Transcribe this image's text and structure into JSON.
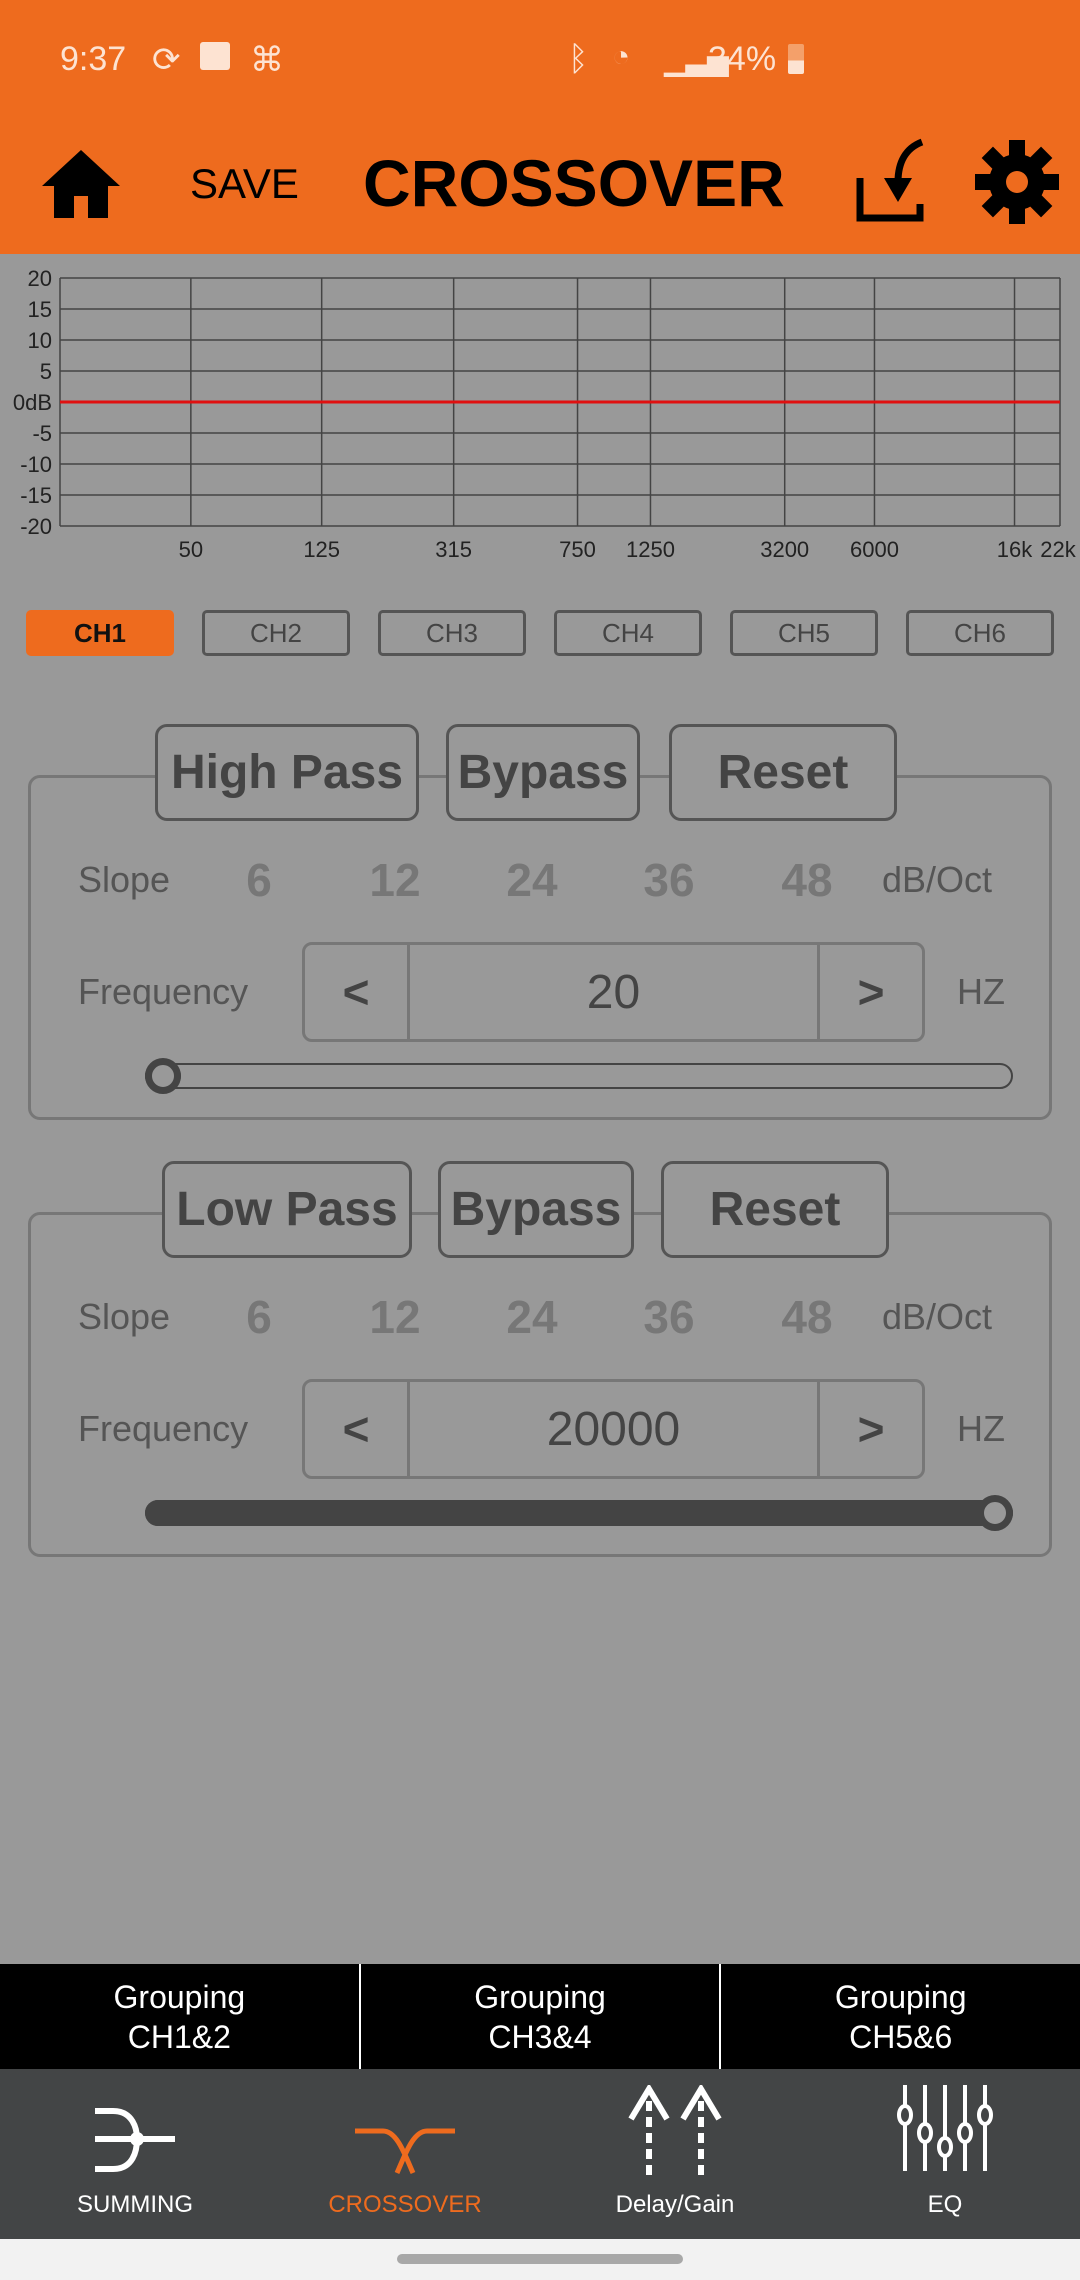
{
  "status_bar": {
    "time": "9:37",
    "battery": "34%",
    "icons": [
      "sync-icon",
      "gallery-icon",
      "app-icon",
      "bluetooth-icon",
      "wifi-icon",
      "signal-icon",
      "battery-icon"
    ]
  },
  "header": {
    "title": "CROSSOVER",
    "save_label": "SAVE",
    "icons": [
      "home-icon",
      "export-icon",
      "gear-icon"
    ],
    "bg_color": "#EE6B1E"
  },
  "chart_data": {
    "type": "line",
    "x_scale": "log",
    "xlim": [
      20,
      22000
    ],
    "ylim": [
      -20,
      20
    ],
    "y_ticks": [
      "20",
      "15",
      "10",
      "5",
      "0dB",
      "-5",
      "-10",
      "-15",
      "-20"
    ],
    "y_tick_values": [
      20,
      15,
      10,
      5,
      0,
      -5,
      -10,
      -15,
      -20
    ],
    "x_ticks": [
      "50",
      "125",
      "315",
      "750",
      "1250",
      "3200",
      "6000",
      "16k",
      "22k"
    ],
    "x_tick_values": [
      50,
      125,
      315,
      750,
      1250,
      3200,
      6000,
      16000,
      22000
    ],
    "grid": true,
    "series": [
      {
        "x": [
          20,
          22000
        ],
        "y": [
          0,
          0
        ],
        "color": "#E01010"
      }
    ]
  },
  "channels": {
    "items": [
      "CH1",
      "CH2",
      "CH3",
      "CH4",
      "CH5",
      "CH6"
    ],
    "selected": "CH1"
  },
  "high_pass": {
    "title": "High Pass",
    "bypass": "Bypass",
    "reset": "Reset",
    "slope_label": "Slope",
    "slopes": [
      "6",
      "12",
      "24",
      "36",
      "48"
    ],
    "slope_unit": "dB/Oct",
    "freq_label": "Frequency",
    "prev": "<",
    "next": ">",
    "value": "20",
    "unit": "HZ",
    "slider_fraction": 0
  },
  "low_pass": {
    "title": "Low Pass",
    "bypass": "Bypass",
    "reset": "Reset",
    "slope_label": "Slope",
    "slopes": [
      "6",
      "12",
      "24",
      "36",
      "48"
    ],
    "slope_unit": "dB/Oct",
    "freq_label": "Frequency",
    "prev": "<",
    "next": ">",
    "value": "20000",
    "unit": "HZ",
    "slider_fraction": 1
  },
  "grouping": [
    {
      "line1": "Grouping",
      "line2": "CH1&2"
    },
    {
      "line1": "Grouping",
      "line2": "CH3&4"
    },
    {
      "line1": "Grouping",
      "line2": "CH5&6"
    }
  ],
  "nav": {
    "items": [
      "SUMMING",
      "CROSSOVER",
      "Delay/Gain",
      "EQ"
    ],
    "active": "CROSSOVER",
    "active_color": "#EE6B1E"
  }
}
